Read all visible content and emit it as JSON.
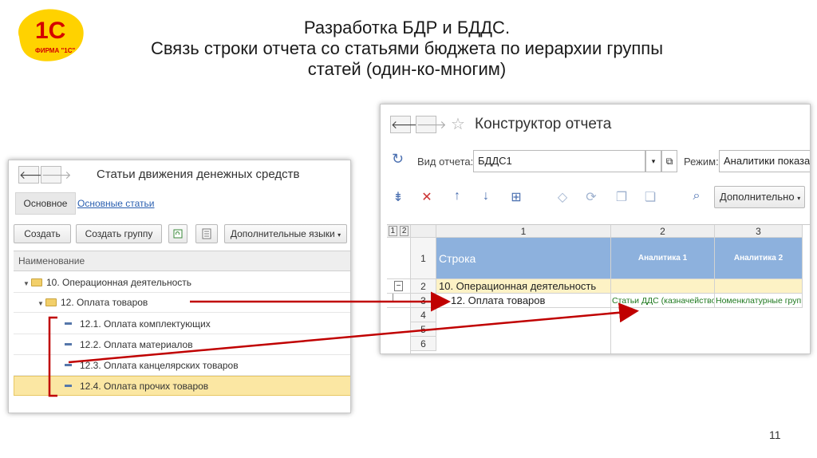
{
  "logo": {
    "brand": "1С",
    "sub": "ФИРМА \"1С\""
  },
  "title": {
    "line1": "Разработка БДР и БДДС.",
    "line2": "Связь строки отчета со статьями бюджета по иерархии группы",
    "line3": "статей (один-ко-многим)"
  },
  "page_number": "11",
  "left_window": {
    "title": "Статьи движения денежных средств",
    "tabs": [
      "Основное",
      "Основные статьи"
    ],
    "buttons": {
      "create": "Создать",
      "create_group": "Создать группу",
      "languages": "Дополнительные языки"
    },
    "column_header": "Наименование",
    "rows": [
      {
        "label": "10. Операционная деятельность",
        "type": "group",
        "level": 0
      },
      {
        "label": "12. Оплата товаров",
        "type": "group",
        "level": 1
      },
      {
        "label": "12.1. Оплата комплектующих",
        "type": "item",
        "level": 2
      },
      {
        "label": "12.2. Оплата материалов",
        "type": "item",
        "level": 2
      },
      {
        "label": "12.3. Оплата канцелярских товаров",
        "type": "item",
        "level": 2
      },
      {
        "label": "12.4. Оплата прочих товаров",
        "type": "item",
        "level": 2,
        "selected": true
      }
    ]
  },
  "right_window": {
    "title": "Конструктор отчета",
    "report_type_label": "Вид отчета:",
    "report_type_value": "БДДС1",
    "mode_label": "Режим:",
    "mode_value": "Аналитики показате",
    "more_button": "Дополнительно",
    "level_buttons": [
      "1",
      "2"
    ],
    "col_headers": [
      "1",
      "2",
      "3"
    ],
    "row_numbers": [
      "1",
      "2",
      "3",
      "4",
      "5",
      "6"
    ],
    "header_row": {
      "c1": "Строка",
      "c2": "Аналитика 1",
      "c3": "Аналитика 2"
    },
    "row2": {
      "c1": "10. Операционная деятельность"
    },
    "row3": {
      "c1": "12. Оплата товаров",
      "c2": "Статьи ДДС (казначейство)",
      "c3": "Номенклатурные группы"
    },
    "collapse_sign": "−"
  },
  "colors": {
    "arrow": "#c00000",
    "selected_row": "#fbe7a3",
    "header_blue": "#8db1dd",
    "link": "#2a5fb0",
    "analytic_text": "#207a20"
  }
}
